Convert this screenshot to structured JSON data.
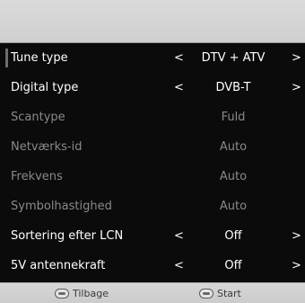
{
  "menu": {
    "rows": [
      {
        "label": "Tune type",
        "value": "DTV + ATV",
        "left_arrow": "<",
        "right_arrow": ">",
        "enabled": true
      },
      {
        "label": "Digital type",
        "value": "DVB-T",
        "left_arrow": "<",
        "right_arrow": ">",
        "enabled": true
      },
      {
        "label": "Scantype",
        "value": "Fuld",
        "left_arrow": "",
        "right_arrow": "",
        "enabled": false
      },
      {
        "label": "Netværks-id",
        "value": "Auto",
        "left_arrow": "",
        "right_arrow": "",
        "enabled": false
      },
      {
        "label": "Frekvens",
        "value": "Auto",
        "left_arrow": "",
        "right_arrow": "",
        "enabled": false
      },
      {
        "label": "Symbolhastighed",
        "value": "Auto",
        "left_arrow": "",
        "right_arrow": "",
        "enabled": false
      },
      {
        "label": "Sortering efter LCN",
        "value": "Off",
        "left_arrow": "<",
        "right_arrow": ">",
        "enabled": true
      },
      {
        "label": "5V antennekraft",
        "value": "Off",
        "left_arrow": "<",
        "right_arrow": ">",
        "enabled": true
      }
    ]
  },
  "footer": {
    "back_label": "Tilbage",
    "start_label": "Start",
    "back_icon": "menu-button-icon",
    "start_icon": "ok-button-icon"
  },
  "colors": {
    "menu_background": "#0b0b0b",
    "active_text": "#ffffff",
    "inactive_text": "#8a8a8a",
    "bar_background": "#d6d6d6"
  }
}
